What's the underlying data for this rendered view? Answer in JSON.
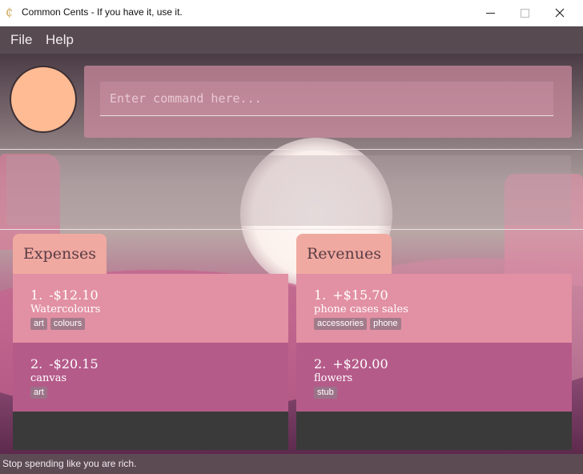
{
  "window": {
    "title": "Common Cents - If you have it, use it.",
    "icon": "cents-icon"
  },
  "menu": {
    "file": "File",
    "help": "Help"
  },
  "command": {
    "placeholder": "Enter command here..."
  },
  "expenses": {
    "tab_label": "Expenses",
    "items": [
      {
        "index": "1.",
        "amount": "-$12.10",
        "description": "Watercolours",
        "tags": [
          "art",
          "colours"
        ]
      },
      {
        "index": "2.",
        "amount": "-$20.15",
        "description": "canvas",
        "tags": [
          "art"
        ]
      }
    ]
  },
  "revenues": {
    "tab_label": "Revenues",
    "items": [
      {
        "index": "1.",
        "amount": "+$15.70",
        "description": "phone cases sales",
        "tags": [
          "accessories",
          "phone"
        ]
      },
      {
        "index": "2.",
        "amount": "+$20.00",
        "description": "flowers",
        "tags": [
          "stub"
        ]
      }
    ]
  },
  "status": {
    "text": "Stop spending like you are rich."
  },
  "colors": {
    "avatar": "#ffbb93",
    "tab": "#f0a9a0",
    "card_primary": "#e290a3",
    "card_secondary": "#b55b8a",
    "menubar": "#574b51"
  }
}
